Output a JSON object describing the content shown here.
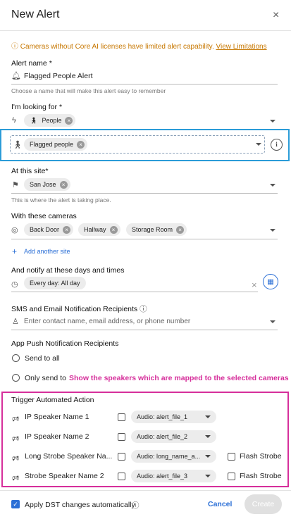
{
  "header": {
    "title": "New Alert",
    "close_icon": "×"
  },
  "warning": {
    "text": "Cameras without Core AI licenses have limited alert capability.",
    "link": "View Limitations",
    "icon": "ⓘ"
  },
  "alert_name": {
    "label": "Alert name *",
    "value": "Flagged People Alert",
    "help": "Choose a name that will make this alert easy to remember"
  },
  "looking_for": {
    "label": "I'm looking for *",
    "chip": "People"
  },
  "flagged": {
    "chip": "Flagged people"
  },
  "site": {
    "label": "At this site*",
    "chip": "San Jose",
    "help": "This is where the alert is taking place."
  },
  "cameras": {
    "label": "With these cameras",
    "chips": [
      "Back Door",
      "Hallway",
      "Storage Room"
    ]
  },
  "add_site": "Add another site",
  "schedule": {
    "label": "And notify at these days and times",
    "chip": "Every day: All day"
  },
  "sms": {
    "label": "SMS and Email Notification Recipients",
    "placeholder": "Enter contact name, email address, or phone number"
  },
  "push": {
    "label": "App Push Notification Recipients",
    "option1": "Send to all",
    "option2": "Only send to"
  },
  "annotation": "Show the speakers which are mapped to the selected cameras",
  "trigger": {
    "label": "Trigger Automated Action",
    "rows": [
      {
        "name": "IP Speaker Name 1",
        "audio": "Audio: alert_file_1",
        "strobe": ""
      },
      {
        "name": "IP Speaker Name 2",
        "audio": "Audio: alert_file_2",
        "strobe": ""
      },
      {
        "name": "Long Strobe Speaker Na...",
        "audio": "Audio: long_name_a...",
        "strobe": "Flash Strobe"
      },
      {
        "name": "Strobe Speaker Name 2",
        "audio": "Audio: alert_file_3",
        "strobe": "Flash Strobe"
      }
    ]
  },
  "footer": {
    "dst_label": "Apply DST changes automatically",
    "cancel": "Cancel",
    "create": "Create"
  },
  "colors": {
    "accent": "#2b6fd6",
    "warning": "#c77700",
    "highlight_blue": "#2b9cd8",
    "highlight_pink": "#d62f9b"
  }
}
